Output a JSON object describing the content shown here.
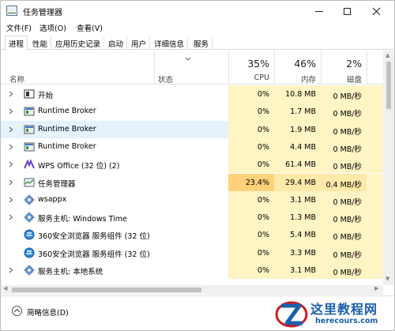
{
  "window": {
    "title": "任务管理器"
  },
  "menu": [
    "文件(F)",
    "选项(O)",
    "查看(V)"
  ],
  "tabs": [
    {
      "label": "进程",
      "active": true
    },
    {
      "label": "性能",
      "active": false
    },
    {
      "label": "应用历史记录",
      "active": false
    },
    {
      "label": "启动",
      "active": false
    },
    {
      "label": "用户",
      "active": false
    },
    {
      "label": "详细信息",
      "active": false
    },
    {
      "label": "服务",
      "active": false
    }
  ],
  "columns": {
    "name": "名称",
    "status": "状态",
    "cpu": {
      "percent": "35%",
      "label": "CPU"
    },
    "memory": {
      "percent": "46%",
      "label": "内存"
    },
    "disk": {
      "percent": "2%",
      "label": "磁盘"
    }
  },
  "processes": [
    {
      "name": "开始",
      "icon": "start-window-icon",
      "cpu": "0%",
      "mem": "10.8 MB",
      "disk": "0 MB/秒",
      "expandable": true
    },
    {
      "name": "Runtime Broker",
      "icon": "app-window-icon",
      "cpu": "0%",
      "mem": "1.7 MB",
      "disk": "0 MB/秒",
      "expandable": true
    },
    {
      "name": "Runtime Broker",
      "icon": "app-window-icon",
      "cpu": "0%",
      "mem": "1.9 MB",
      "disk": "0 MB/秒",
      "expandable": true,
      "selected": true
    },
    {
      "name": "Runtime Broker",
      "icon": "app-window-icon",
      "cpu": "0%",
      "mem": "4.4 MB",
      "disk": "0 MB/秒",
      "expandable": true
    },
    {
      "name": "WPS Office (32 位) (2)",
      "icon": "wps-icon",
      "cpu": "0%",
      "mem": "61.4 MB",
      "disk": "0 MB/秒",
      "expandable": true
    },
    {
      "name": "任务管理器",
      "icon": "task-manager-icon",
      "cpu": "23.4%",
      "mem": "29.4 MB",
      "disk": "0.4 MB/秒",
      "expandable": true,
      "hot": true
    },
    {
      "name": "wsappx",
      "icon": "gear-icon",
      "cpu": "0%",
      "mem": "3.1 MB",
      "disk": "0 MB/秒",
      "expandable": true
    },
    {
      "name": "服务主机: Windows Time",
      "icon": "gear-icon",
      "cpu": "0%",
      "mem": "1.3 MB",
      "disk": "0 MB/秒",
      "expandable": true
    },
    {
      "name": "360安全浏览器 服务组件 (32 位)",
      "icon": "browser-360-icon",
      "cpu": "0%",
      "mem": "5.4 MB",
      "disk": "0 MB/秒",
      "expandable": false
    },
    {
      "name": "360安全浏览器 服务组件 (32 位)",
      "icon": "browser-360-icon",
      "cpu": "0%",
      "mem": "3.3 MB",
      "disk": "0 MB/秒",
      "expandable": false
    },
    {
      "name": "服务主机: 本地系统",
      "icon": "gear-icon",
      "cpu": "0%",
      "mem": "3.1 MB",
      "disk": "0 MB/秒",
      "expandable": true
    }
  ],
  "footer": {
    "label": "简略信息(D)"
  },
  "watermark": {
    "title": "这里教程网",
    "url": "herecours.com"
  },
  "colors": {
    "heat_low": "#fff4c4",
    "heat_high": "#ffd27a",
    "selected_row": "#e5f1fb",
    "brand_blue": "#1c5fae"
  }
}
